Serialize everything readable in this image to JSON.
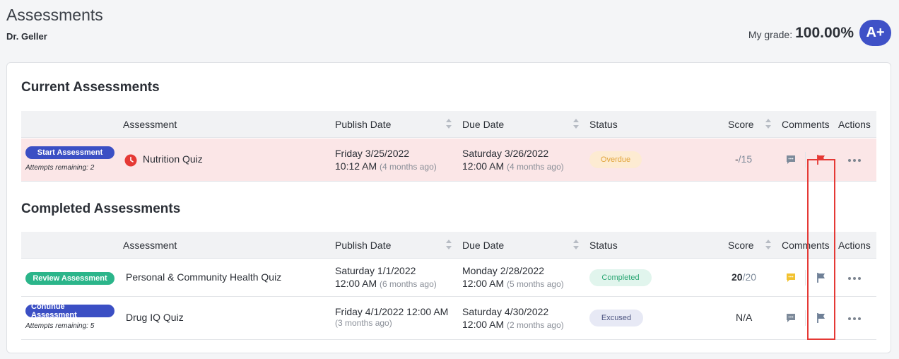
{
  "header": {
    "title": "Assessments",
    "teacher": "Dr. Geller",
    "grade_label": "My grade:",
    "grade_value": "100.00%",
    "grade_letter": "A+"
  },
  "columns": {
    "assessment": "Assessment",
    "publish_date": "Publish Date",
    "due_date": "Due Date",
    "status": "Status",
    "score": "Score",
    "comments": "Comments",
    "actions": "Actions"
  },
  "current": {
    "title": "Current Assessments",
    "rows": [
      {
        "button": "Start Assessment",
        "attempts": "Attempts remaining: 2",
        "name": "Nutrition Quiz",
        "publish_line1": "Friday 3/25/2022",
        "publish_line2": "10:12 AM",
        "publish_ago": "(4 months ago)",
        "due_line1": "Saturday 3/26/2022",
        "due_line2": "12:00 AM",
        "due_ago": "(4 months ago)",
        "status": "Overdue",
        "score_num": "-",
        "score_den": "/15"
      }
    ]
  },
  "completed": {
    "title": "Completed Assessments",
    "rows": [
      {
        "button": "Review Assessment",
        "name": "Personal & Community Health Quiz",
        "publish_line1": "Saturday 1/1/2022",
        "publish_line2": "12:00 AM",
        "publish_ago": "(6 months ago)",
        "due_line1": "Monday 2/28/2022",
        "due_line2": "12:00 AM",
        "due_ago": "(5 months ago)",
        "status": "Completed",
        "score_num": "20",
        "score_den": "/20"
      },
      {
        "button": "Continue Assessment",
        "attempts": "Attempts remaining: 5",
        "name": "Drug IQ Quiz",
        "publish_line1": "Friday 4/1/2022 12:00 AM",
        "publish_ago": "(3 months ago)",
        "due_line1": "Saturday 4/30/2022",
        "due_line2": "12:00 AM",
        "due_ago": "(2 months ago)",
        "status": "Excused",
        "score": "N/A"
      }
    ]
  },
  "colors": {
    "primary": "#3f51c7",
    "overdue_row": "#fbe6e7",
    "flag_active": "#e53935",
    "flag_inactive": "#6f8097",
    "comment_active": "#f2c230",
    "comment_inactive": "#7d8a9a",
    "highlight": "#e53935"
  },
  "icons": {
    "overdue": "clock-icon",
    "comment": "comment-icon",
    "flag": "flag-icon",
    "actions": "more-dots-icon"
  }
}
